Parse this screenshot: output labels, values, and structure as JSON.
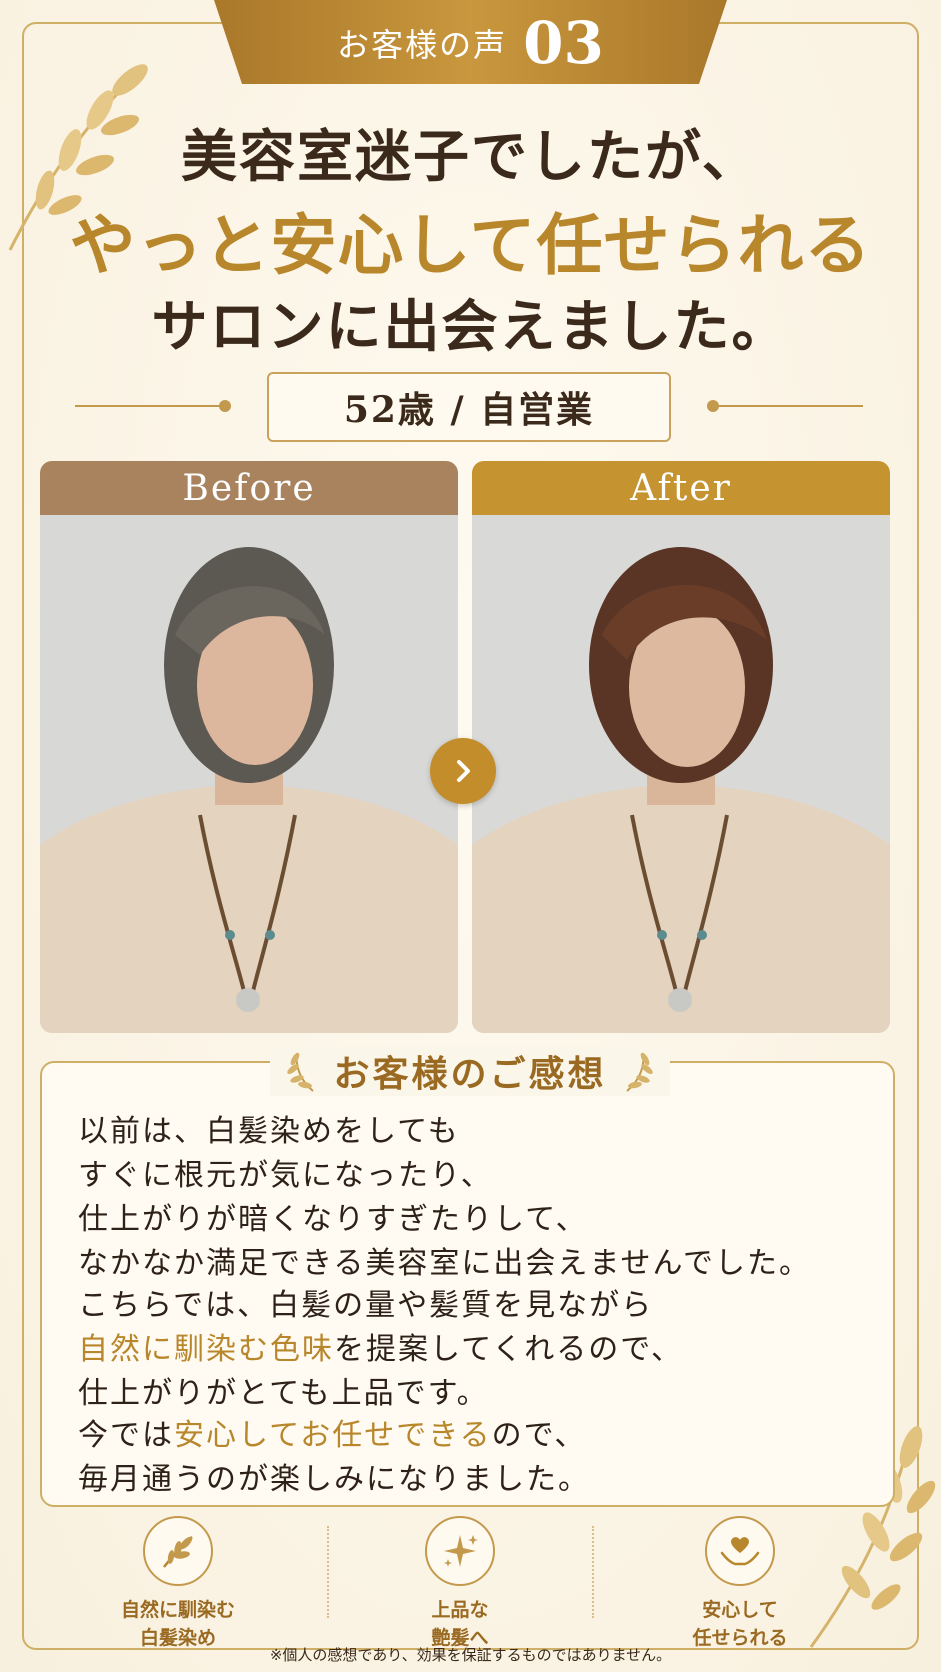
{
  "header": {
    "label": "お客様の声",
    "number": "03"
  },
  "headline": {
    "line1": "美容室迷子でしたが、",
    "line2": "やっと安心して任せられる",
    "line3": "サロンに出会えました。"
  },
  "profile": {
    "text": "52歳 / 自営業"
  },
  "photos": {
    "before_label": "Before",
    "after_label": "After"
  },
  "review": {
    "title": "お客様のご感想",
    "p1_lines": [
      "以前は、白髪染めをしても",
      "すぐに根元が気になったり、",
      "仕上がりが暗くなりすぎたりして、",
      "なかなか満足できる美容室に出会えませんでした。"
    ],
    "p2_l1": "こちらでは、白髪の量や髪質を見ながら",
    "p2_l2_highlight": "自然に馴染む色味",
    "p2_l2_rest": "を提案してくれるので、",
    "p2_l3": "仕上がりがとても上品です。",
    "p3_l1_pre": "今では",
    "p3_l1_highlight": "安心してお任せできる",
    "p3_l1_rest": "ので、",
    "p3_l2": "毎月通うのが楽しみになりました。"
  },
  "features": [
    {
      "icon": "leaf-icon",
      "line1": "自然に馴染む",
      "line2": "白髪染め"
    },
    {
      "icon": "sparkle-icon",
      "line1": "上品な",
      "line2": "艶髪へ"
    },
    {
      "icon": "heart-hands-icon",
      "line1": "安心して",
      "line2": "任せられる"
    }
  ],
  "disclaimer": "※個人の感想であり、効果を保証するものではありません。",
  "colors": {
    "gold": "#b8862b",
    "dark_brown": "#3b2a1c",
    "before_bar": "#a8835e",
    "after_bar": "#c5932f",
    "background": "#fbf6ea"
  }
}
